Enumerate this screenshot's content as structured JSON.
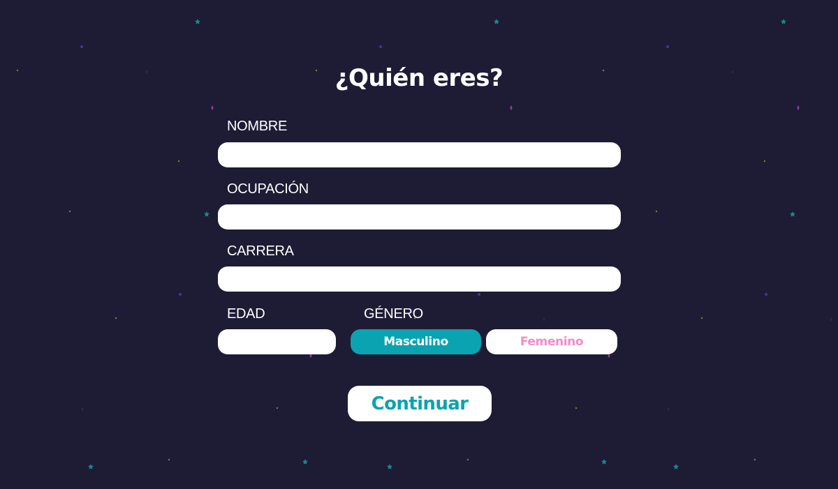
{
  "page": {
    "title": "¿Quién eres?"
  },
  "form": {
    "name_label": "NOMBRE",
    "name_value": "",
    "occupation_label": "OCUPACIÓN",
    "occupation_value": "",
    "career_label": "CARRERA",
    "career_value": "",
    "age_label": "EDAD",
    "age_value": "",
    "gender_label": "GÉNERO",
    "gender_options": [
      "Masculino",
      "Femenino"
    ],
    "gender_selected": "Masculino",
    "continue_label": "Continuar"
  },
  "colors": {
    "background": "#1e1b35",
    "accent_teal": "#0aa3b1",
    "accent_pink": "#f48cc6",
    "star_teal": "#1a8a8e",
    "star_purple": "#3f3a8e",
    "star_gold": "#8a7a3a",
    "star_magenta": "#8a3f8e"
  },
  "icons": {
    "background_stars": "star-icon",
    "background_drops": "drop-icon"
  }
}
